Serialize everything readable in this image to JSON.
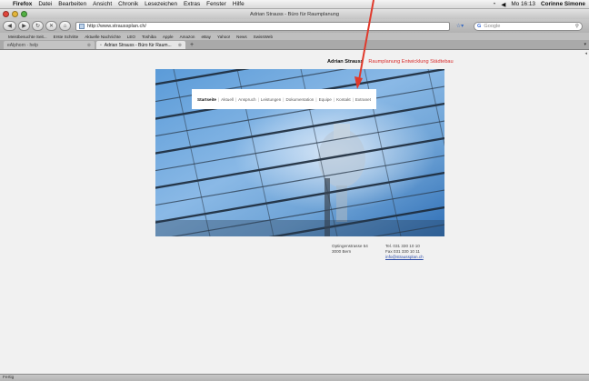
{
  "menubar": {
    "apple_glyph": "",
    "app_name": "Firefox",
    "items": [
      "Datei",
      "Bearbeiten",
      "Ansicht",
      "Chronik",
      "Lesezeichen",
      "Extras",
      "Fenster",
      "Hilfe"
    ],
    "clock": "Mo 16:13",
    "user": "Corinne Simone"
  },
  "window": {
    "title": "Adrian Strauss - Büro für Raumplanung"
  },
  "toolbar": {
    "url": "http://www.straussplan.ch/",
    "search_placeholder": "Google",
    "google_mark": "G"
  },
  "bookmarks": [
    "Meistbesuchte Seit...",
    "Erste Schritte",
    "Aktuelle Nachrichte",
    "LEO",
    "Toshiba",
    "Apple",
    "Amazon",
    "eBay",
    "Yahoo!",
    "News",
    "SwissWeb"
  ],
  "tabs": [
    {
      "label": "eAlphorn · help",
      "active": false
    },
    {
      "label": "Adrian Strauss - Büro für Raum...",
      "active": true
    }
  ],
  "site": {
    "owner": "Adrian Strauss",
    "tagline": "Raumplanung Entwicklung Städtebau",
    "nav": [
      "Startseite",
      "Aktuell",
      "Anspruch",
      "Leistungen",
      "Dokumentation",
      "Equipe",
      "Kontakt",
      "Extranet"
    ],
    "nav_active": "Startseite",
    "address": {
      "street": "Optingenstrasse 54",
      "city": "3000 Bern"
    },
    "contact": {
      "tel": "Tel. 031 330 10 10",
      "fax": "Fax 031 330 10 11",
      "email": "info@straussplan.ch"
    }
  },
  "status": {
    "text": "Fertig"
  },
  "colors": {
    "tagline": "#d82c2c",
    "annotation_arrow": "#e0392b",
    "link": "#2a4aa8"
  }
}
